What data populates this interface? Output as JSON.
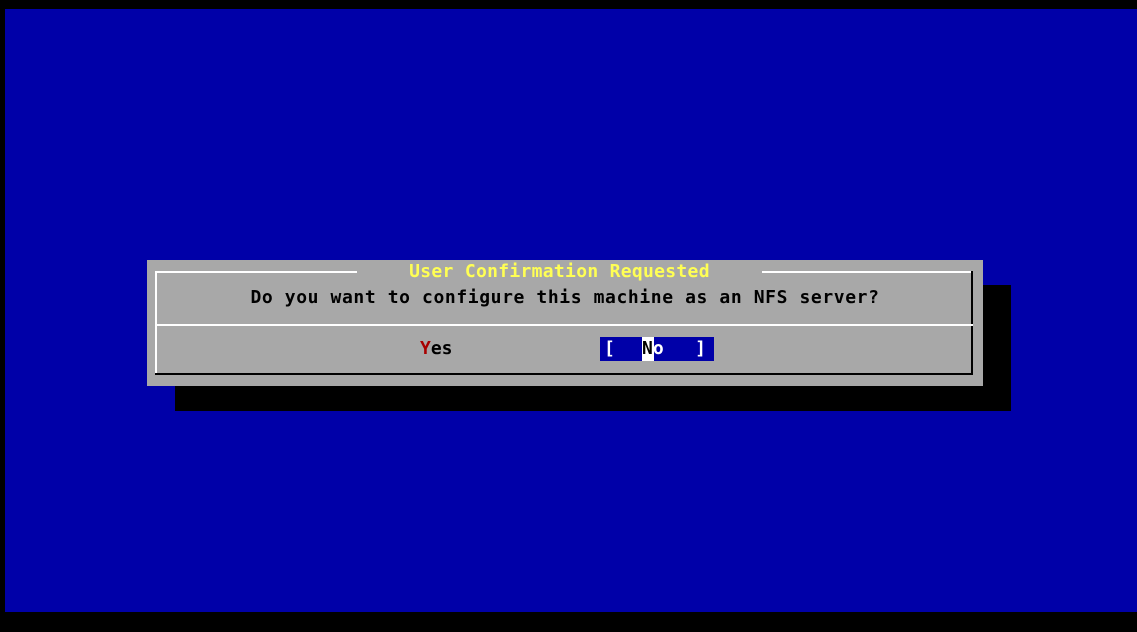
{
  "dialog": {
    "title": " User Confirmation Requested ",
    "message": "Do you want to configure this machine as an NFS server?",
    "buttons": {
      "yes": {
        "hotkey": "Y",
        "rest": "es",
        "selected": false
      },
      "no": {
        "open_bracket": "[",
        "hotkey": "N",
        "rest": "o",
        "close_bracket": "]",
        "selected": true
      }
    }
  },
  "colors": {
    "desktop_background": "#0000a8",
    "dialog_background": "#a8a8a8",
    "title_text": "#ffff54",
    "hotkey_text": "#a80000",
    "selected_button_background": "#0000a8",
    "shadow": "#000000"
  }
}
